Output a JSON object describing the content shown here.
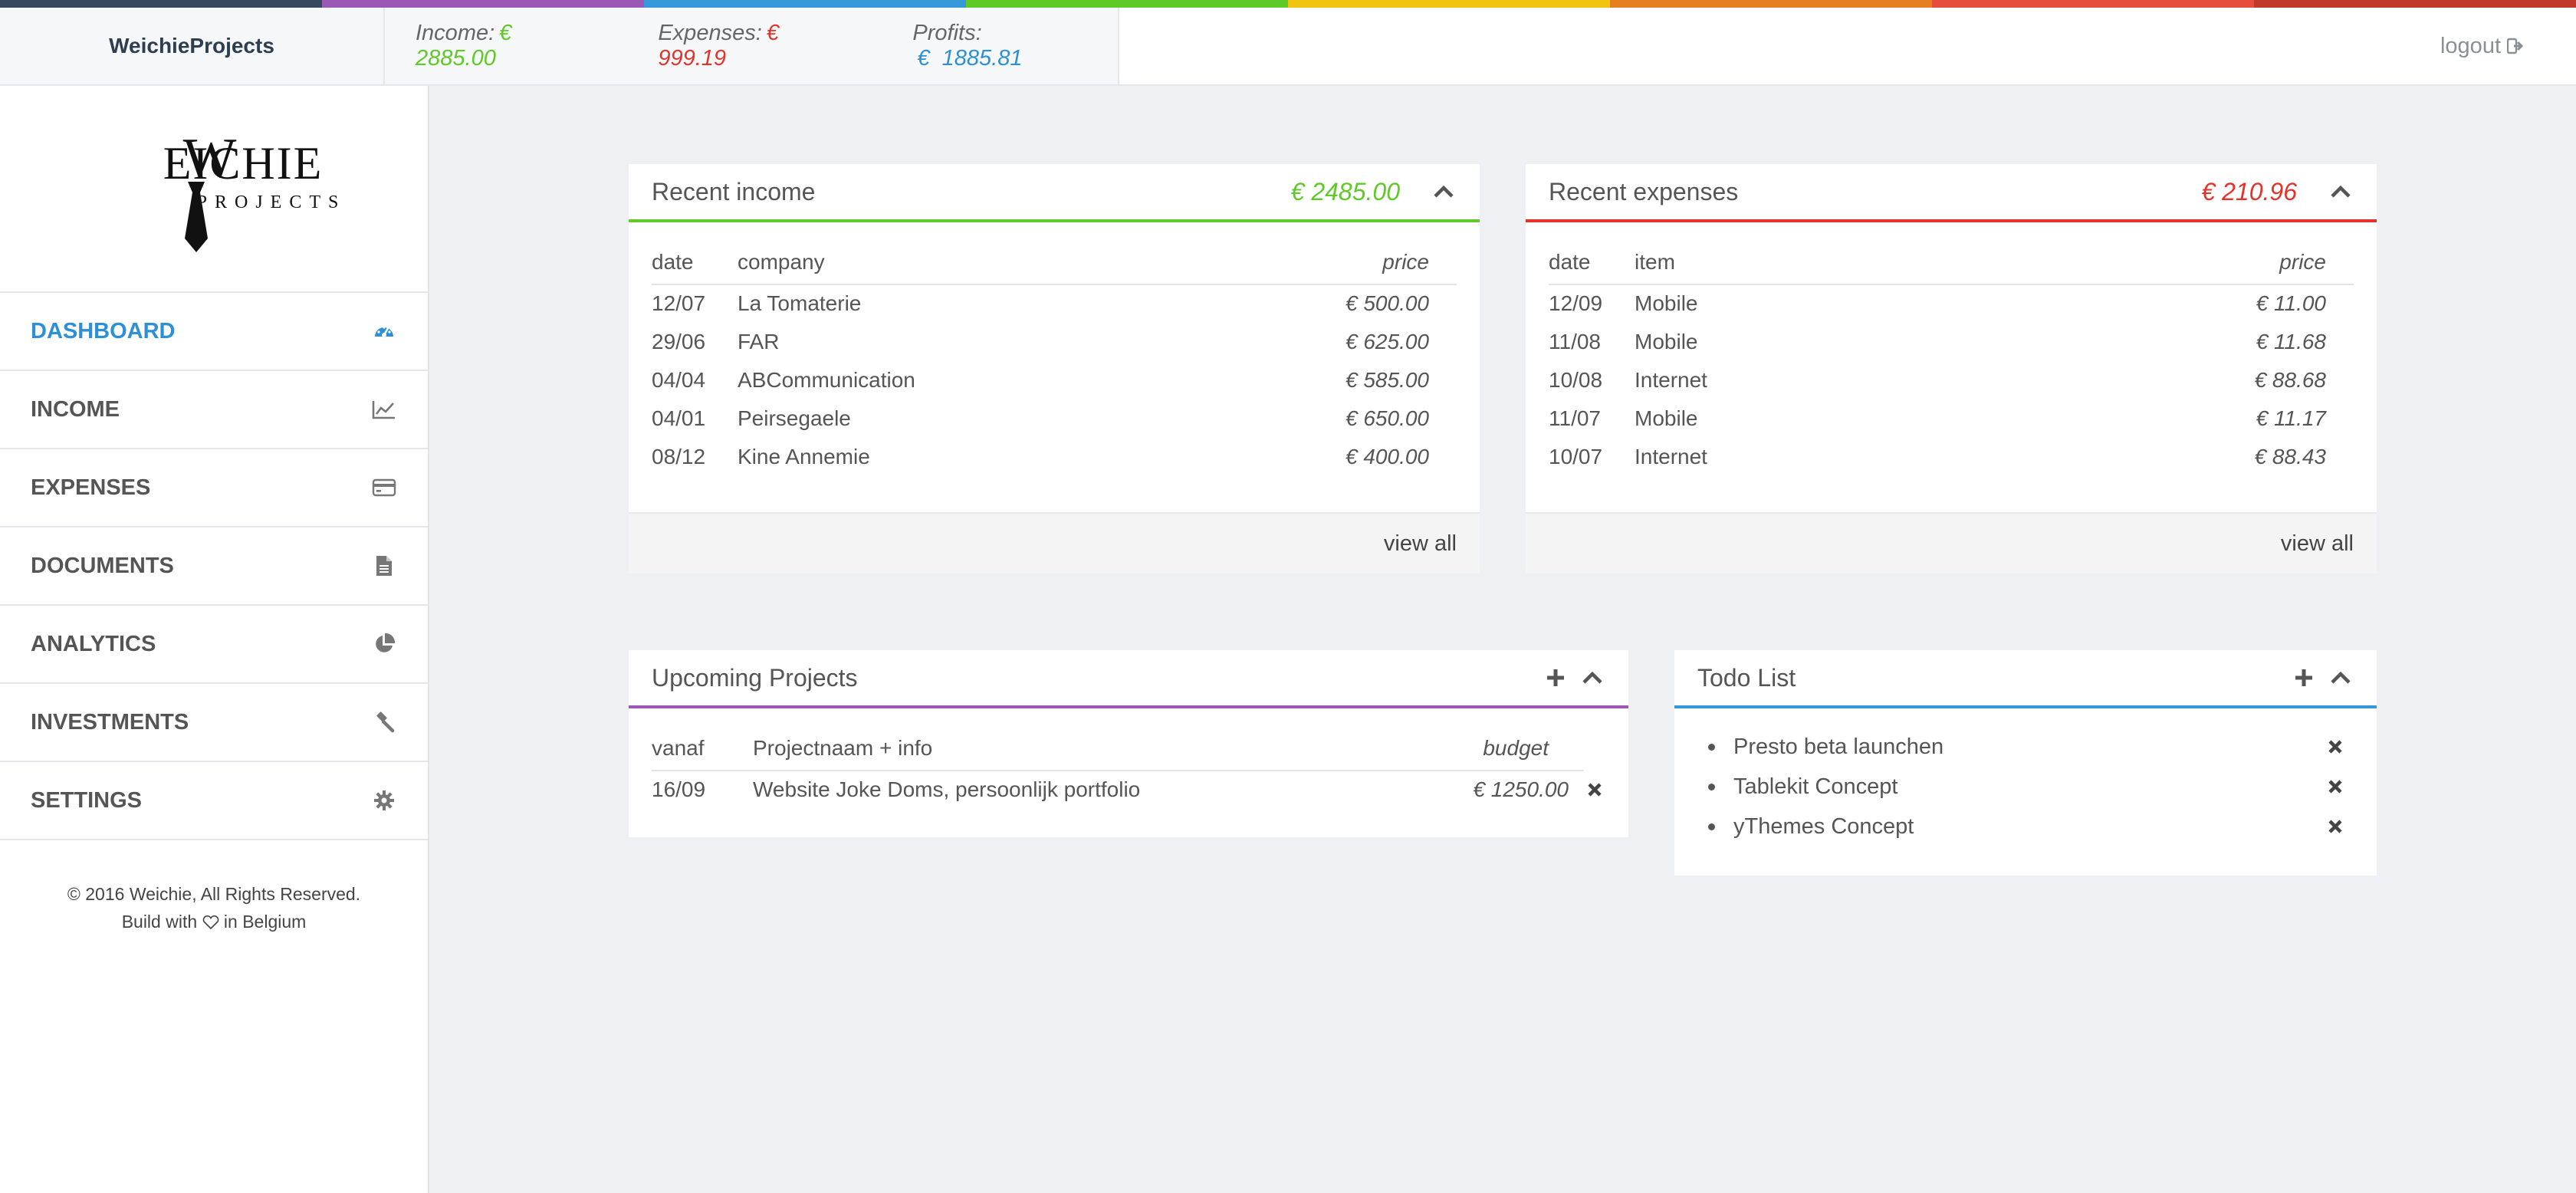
{
  "colors": {
    "strip": [
      "#34495e",
      "#9b59b6",
      "#3498db",
      "#5fc927",
      "#f1c40f",
      "#e67e22",
      "#e74c3c",
      "#c0392b"
    ],
    "income": "#5fc927",
    "expense": "#e5322b",
    "profit": "#2d8fd5",
    "projects": "#9b59b6",
    "todo": "#3498db",
    "active_nav": "#2d8fd5"
  },
  "header": {
    "brand": "WeichieProjects",
    "income_label": "Income:",
    "income_value": "€ 2885.00",
    "expenses_label": "Expenses:",
    "expenses_value": "€ 999.19",
    "profits_label": "Profits:",
    "profits_value": "€  1885.81",
    "logout": "logout"
  },
  "logo": {
    "word1": "WEICHIE",
    "word2": "PROJECTS"
  },
  "sidebar": {
    "items": [
      {
        "label": "DASHBOARD",
        "icon": "dashboard-icon",
        "active": true
      },
      {
        "label": "INCOME",
        "icon": "line-chart-icon"
      },
      {
        "label": "EXPENSES",
        "icon": "credit-card-icon"
      },
      {
        "label": "DOCUMENTS",
        "icon": "document-icon"
      },
      {
        "label": "ANALYTICS",
        "icon": "pie-chart-icon"
      },
      {
        "label": "INVESTMENTS",
        "icon": "gavel-icon"
      },
      {
        "label": "SETTINGS",
        "icon": "gear-icon"
      }
    ],
    "footer_line1": "© 2016 Weichie, All Rights Reserved.",
    "footer_line2_pre": "Build with",
    "footer_line2_post": "in Belgium"
  },
  "income_panel": {
    "title": "Recent income",
    "amount": "€ 2485.00",
    "columns": [
      "date",
      "company",
      "price"
    ],
    "rows": [
      [
        "12/07",
        "La Tomaterie",
        "€ 500.00"
      ],
      [
        "29/06",
        "FAR",
        "€ 625.00"
      ],
      [
        "04/04",
        "ABCommunication",
        "€ 585.00"
      ],
      [
        "04/01",
        "Peirsegaele",
        "€ 650.00"
      ],
      [
        "08/12",
        "Kine Annemie",
        "€ 400.00"
      ]
    ],
    "view_all": "view all"
  },
  "expenses_panel": {
    "title": "Recent expenses",
    "amount": "€ 210.96",
    "columns": [
      "date",
      "item",
      "price"
    ],
    "rows": [
      [
        "12/09",
        "Mobile",
        "€ 11.00"
      ],
      [
        "11/08",
        "Mobile",
        "€ 11.68"
      ],
      [
        "10/08",
        "Internet",
        "€ 88.68"
      ],
      [
        "11/07",
        "Mobile",
        "€ 11.17"
      ],
      [
        "10/07",
        "Internet",
        "€ 88.43"
      ]
    ],
    "view_all": "view all"
  },
  "projects_panel": {
    "title": "Upcoming Projects",
    "columns": [
      "vanaf",
      "Projectnaam + info",
      "budget"
    ],
    "rows": [
      [
        "16/09",
        "Website Joke Doms, persoonlijk portfolio",
        "€ 1250.00"
      ]
    ]
  },
  "todo_panel": {
    "title": "Todo List",
    "items": [
      "Presto beta launchen",
      "Tablekit Concept",
      "yThemes Concept"
    ]
  }
}
